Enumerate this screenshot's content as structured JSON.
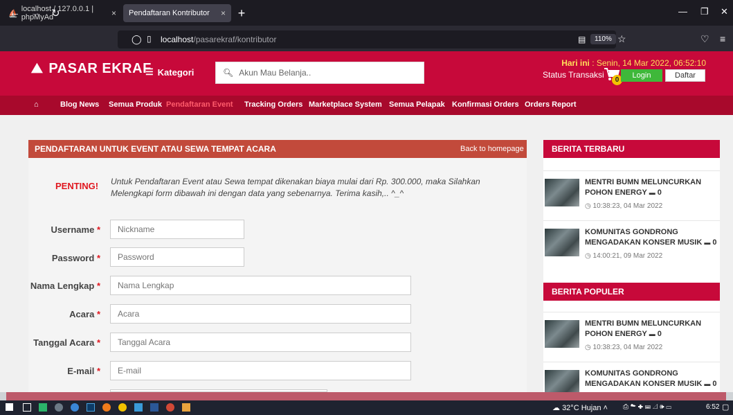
{
  "browser": {
    "tab1_title": "localhost / 127.0.0.1 | phpMyAd",
    "tab2_title": "Pendaftaran Kontributor",
    "url_host": "localhost",
    "url_path": "/pasarekraf/kontributor",
    "zoom": "110%"
  },
  "site": {
    "logo": "PASAR EKRAF",
    "kategori": "Kategori",
    "search_placeholder": "Akun Mau Belanja..",
    "hari_ini_label": "Hari ini",
    "hari_ini_value": " : Senin, 14 Mar 2022, 06:52:10",
    "status_transaksi": "Status Transaksi",
    "cart_count": "0",
    "login": "Login",
    "daftar": "Daftar"
  },
  "menu": [
    "Blog News",
    "Semua Produk",
    "Pendaftaran Event",
    "Tracking Orders",
    "Marketplace System",
    "Semua Pelapak",
    "Konfirmasi Orders",
    "Orders Report"
  ],
  "form": {
    "title": "PENDAFTARAN UNTUK EVENT ATAU SEWA TEMPAT ACARA",
    "back": "Back to homepage",
    "penting": "PENTING!",
    "notice": "Untuk Pendaftaran Event atau Sewa tempat dikenakan biaya mulai dari Rp. 300.000, maka Silahkan Melengkapi form dibawah ini dengan data yang sebenarnya. Terima kasih,.. ^_^",
    "required_mark": "*",
    "fields": [
      {
        "label": "Username",
        "placeholder": "Nickname"
      },
      {
        "label": "Password",
        "placeholder": "Password"
      },
      {
        "label": "Nama Lengkap",
        "placeholder": "Nama Lengkap"
      },
      {
        "label": "Acara",
        "placeholder": "Acara"
      },
      {
        "label": "Tanggal Acara",
        "placeholder": "Tanggal Acara"
      },
      {
        "label": "E-mail",
        "placeholder": "E-mail"
      }
    ]
  },
  "sidebar": {
    "terbaru_title": "BERITA TERBARU",
    "populer_title": "BERITA POPULER",
    "terbaru": [
      {
        "title": "MENTRI BUMN MELUNCURKAN POHON ENERGY",
        "comments": "0",
        "time": "10:38:23, 04 Mar 2022"
      },
      {
        "title": "KOMUNITAS GONDRONG MENGADAKAN KONSER MUSIK",
        "comments": "0",
        "time": "14:00:21, 09 Mar 2022"
      }
    ],
    "populer": [
      {
        "title": "MENTRI BUMN MELUNCURKAN POHON ENERGY",
        "comments": "0",
        "time": "10:38:23, 04 Mar 2022"
      },
      {
        "title": "KOMUNITAS GONDRONG MENGADAKAN KONSER MUSIK",
        "comments": "0"
      }
    ]
  },
  "taskbar": {
    "weather": "32°C  Hujan",
    "clock": "6:52"
  },
  "colors": {
    "brand": "#c7093a",
    "menubar": "#a8092c",
    "form_header": "#c24a3b",
    "login": "#3fb83a"
  }
}
